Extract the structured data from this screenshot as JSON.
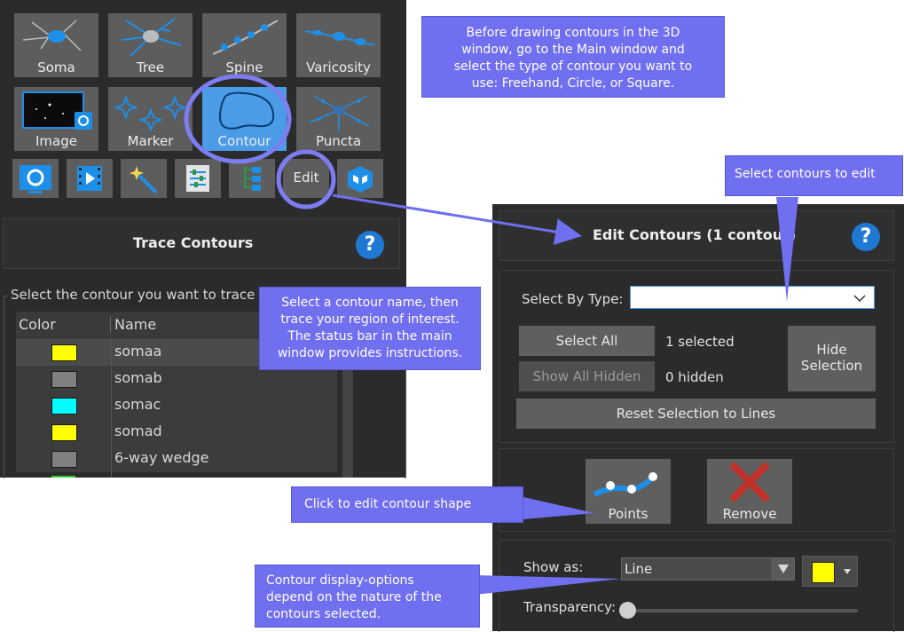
{
  "toolbar": {
    "row1": [
      "Soma",
      "Tree",
      "Spine",
      "Varicosity"
    ],
    "row2": [
      "Image",
      "Marker",
      "Contour",
      "Puncta"
    ],
    "edit_label": "Edit"
  },
  "trace_panel": {
    "title": "Trace Contours",
    "help": "?",
    "instruction": "Select the contour you want to trace",
    "columns": [
      "Color",
      "Name"
    ],
    "rows": [
      {
        "name": "somaa",
        "color": "#ffff00"
      },
      {
        "name": "somab",
        "color": "#808080"
      },
      {
        "name": "somac",
        "color": "#00ffff"
      },
      {
        "name": "somad",
        "color": "#ffff00"
      },
      {
        "name": "6-way wedge",
        "color": "#808080"
      }
    ]
  },
  "edit_panel": {
    "title": "Edit Contours (1 contour)",
    "help": "?",
    "select_by_type_label": "Select By Type:",
    "select_by_type_value": "",
    "select_all": "Select All",
    "selected_count": "1 selected",
    "show_all_hidden": "Show All Hidden",
    "hidden_count": "0 hidden",
    "hide_selection_line1": "Hide",
    "hide_selection_line2": "Selection",
    "reset_selection": "Reset Selection to Lines",
    "points": "Points",
    "remove": "Remove",
    "show_as_label": "Show as:",
    "show_as_value": "Line",
    "color_value": "#ffff00",
    "transparency_label": "Transparency:",
    "transparency": 0
  },
  "callouts": {
    "top_right": [
      "Before drawing contours in the 3D",
      "window, go to the Main window and",
      "select the type of contour you want to",
      "use: Freehand, Circle, or Square."
    ],
    "select_to_edit": "Select contours to edit",
    "select_name": [
      "Select a contour name, then",
      "trace your region of interest.",
      "The status bar in the main",
      "window provides instructions."
    ],
    "edit_shape": "Click to edit contour shape",
    "display_options": [
      "Contour display-options",
      "depend on the nature of the",
      "contours selected."
    ]
  },
  "colors": {
    "accent_callout": "#6f6ff0",
    "selected_tool": "#4b9be6",
    "panel_bg": "#2b2b2b"
  }
}
